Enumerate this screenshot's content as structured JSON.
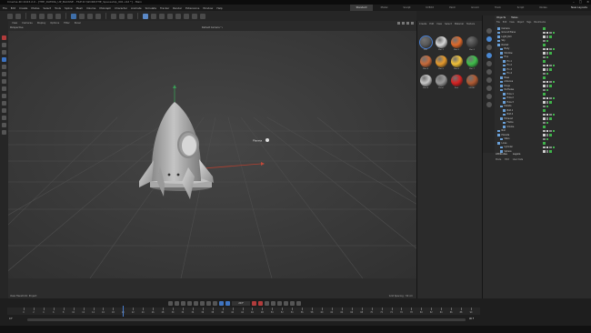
{
  "window": {
    "title": "Cinema 4D 2023.2.0 - [THE_DATING_UP_BACKSE - FILE:D:\\WORK\\THE_Spaceship_001.c4d *] - Main",
    "controls": [
      "–",
      "□",
      "×"
    ]
  },
  "menu": [
    "File",
    "Edit",
    "Create",
    "Modes",
    "Select",
    "Tools",
    "Spline",
    "Mesh",
    "Volume",
    "MoGraph",
    "Character",
    "Animate",
    "Simulate",
    "Tracker",
    "Render",
    "Extensions",
    "Window",
    "Help"
  ],
  "layout_tabs": {
    "items": [
      "Standard",
      "Model",
      "Sculpt",
      "UVEdit",
      "Paint",
      "Groom",
      "Track",
      "Script",
      "Nodes"
    ],
    "active": "Standard",
    "new_layouts": "New Layouts"
  },
  "viewport": {
    "menu": [
      "View",
      "Cameras",
      "Display",
      "Options",
      "Filter",
      "Panel"
    ],
    "label": "Perspective",
    "camera": "Default Camera °•",
    "grid_spacing": "Grid Spacing : 50 cm",
    "view_transform": "View Transform: Project",
    "object_label": "Planeta"
  },
  "material_manager": {
    "menu": [
      "Create",
      "Edit",
      "View",
      "Select",
      "Material",
      "Texture"
    ],
    "materials": [
      {
        "label": "Mat",
        "color": "#5a5a5a"
      },
      {
        "label": "Mat.1",
        "color": "#d8d8d8"
      },
      {
        "label": "Mat.2",
        "color": "#e0692a"
      },
      {
        "label": "Mat.3",
        "color": "#4a4a4a"
      },
      {
        "label": "Mat.4",
        "color": "#c86a3a"
      },
      {
        "label": "Mat.5",
        "color": "#e69a2c"
      },
      {
        "label": "Mat.6",
        "color": "#f2c237"
      },
      {
        "label": "Mat.7",
        "color": "#3fbf4a"
      },
      {
        "label": "Mat.8",
        "color": "#c8c8c8"
      },
      {
        "label": "Metal",
        "color": "#9a9a9a"
      },
      {
        "label": "Red",
        "color": "#d62222"
      },
      {
        "label": "ENTRY",
        "color": "#b05a32"
      }
    ]
  },
  "objects": {
    "tabs": [
      "Objects",
      "Takes"
    ],
    "menu": [
      "File",
      "Edit",
      "View",
      "Object",
      "Tags",
      "Bookmarks"
    ],
    "rows": [
      {
        "name": "Camera",
        "indent": 0
      },
      {
        "name": "Ground Plane",
        "indent": 0
      },
      {
        "name": "Light_Rim",
        "indent": 0
      },
      {
        "name": "Sky",
        "indent": 0
      },
      {
        "name": "Rocket",
        "indent": 0
      },
      {
        "name": "Body",
        "indent": 1
      },
      {
        "name": "Window",
        "indent": 1
      },
      {
        "name": "Fins",
        "indent": 1
      },
      {
        "name": "Fin.1",
        "indent": 2
      },
      {
        "name": "Fin.2",
        "indent": 2
      },
      {
        "name": "Fin.3",
        "indent": 2
      },
      {
        "name": "Fin.4",
        "indent": 2
      },
      {
        "name": "Base",
        "indent": 1
      },
      {
        "name": "Antenna",
        "indent": 1
      },
      {
        "name": "Rings",
        "indent": 1
      },
      {
        "name": "Portholes",
        "indent": 1
      },
      {
        "name": "Hole.1",
        "indent": 2
      },
      {
        "name": "Hole.2",
        "indent": 2
      },
      {
        "name": "Hole.3",
        "indent": 2
      },
      {
        "name": "Details",
        "indent": 1
      },
      {
        "name": "Bolt.1",
        "indent": 2
      },
      {
        "name": "Bolt.2",
        "indent": 2
      },
      {
        "name": "Exhaust",
        "indent": 1
      },
      {
        "name": "Flame",
        "indent": 2
      },
      {
        "name": "Smoke",
        "indent": 2
      },
      {
        "name": "Null",
        "indent": 0
      },
      {
        "name": "Planeta",
        "indent": 0
      },
      {
        "name": "Stars",
        "indent": 1
      },
      {
        "name": "Lines",
        "indent": 0
      },
      {
        "name": "Cylinder",
        "indent": 1
      },
      {
        "name": "Sphere",
        "indent": 1
      },
      {
        "name": "Sphere.1",
        "indent": 1
      }
    ]
  },
  "attributes": {
    "tabs": [
      "Attributes",
      "Layers"
    ],
    "menu": [
      "Mode",
      "Edit",
      "User Data"
    ]
  },
  "timeline": {
    "current_frame": "20 F",
    "start": "0 F",
    "end": "90 F",
    "end_right": "90 F",
    "ticks": [
      "0",
      "2",
      "4",
      "6",
      "8",
      "10",
      "12",
      "14",
      "16",
      "18",
      "20",
      "22",
      "24",
      "26",
      "28",
      "30",
      "32",
      "34",
      "36",
      "38",
      "40",
      "42",
      "44",
      "46",
      "48",
      "50",
      "52",
      "54",
      "56",
      "58",
      "60",
      "62",
      "64",
      "66",
      "68",
      "70",
      "72",
      "74",
      "76",
      "78",
      "80",
      "82",
      "84",
      "86",
      "88",
      "90"
    ],
    "playhead_frame": 20
  }
}
